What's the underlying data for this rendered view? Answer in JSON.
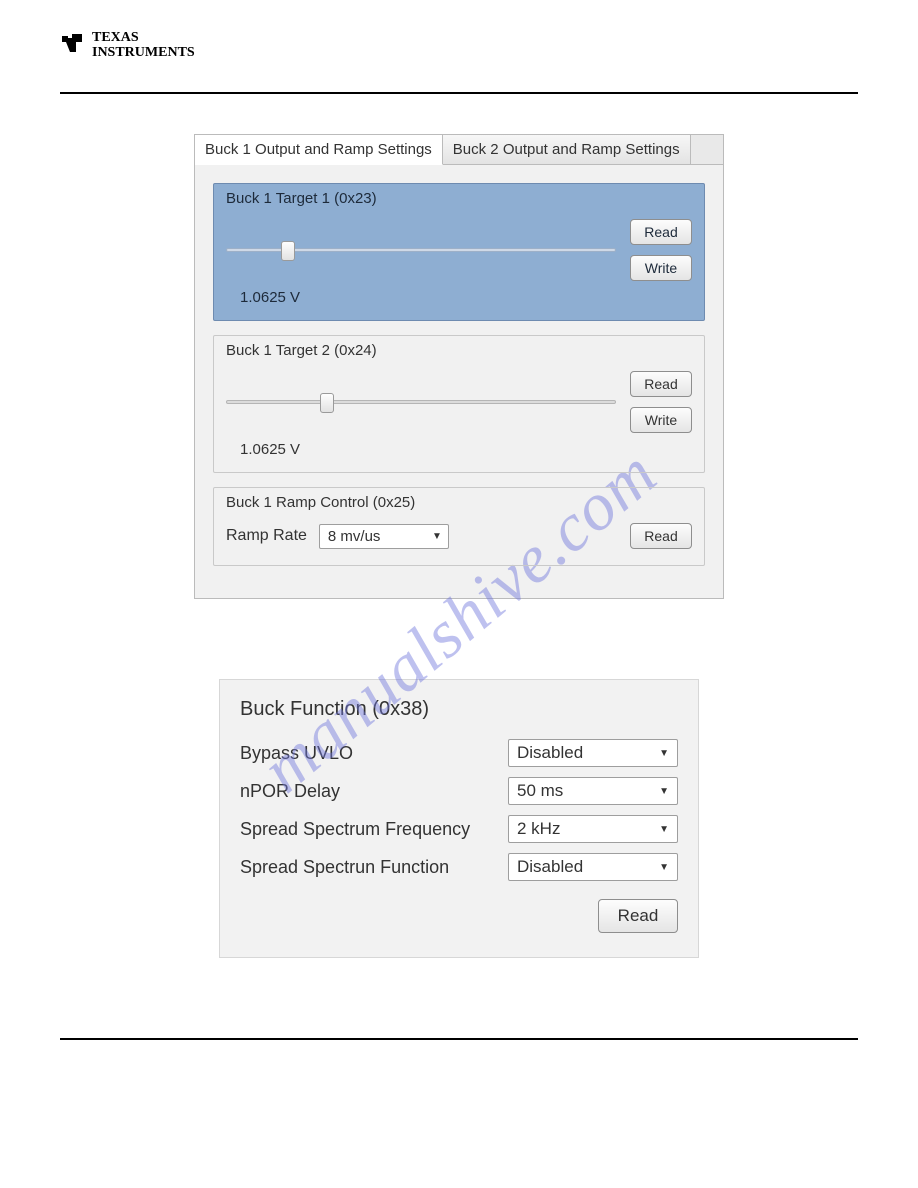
{
  "header": {
    "logo_line1": "TEXAS",
    "logo_line2": "INSTRUMENTS"
  },
  "watermark": "manualshive.com",
  "panel1": {
    "tabs": [
      {
        "label": "Buck 1 Output and Ramp Settings",
        "active": true
      },
      {
        "label": "Buck 2 Output and Ramp Settings",
        "active": false
      }
    ],
    "target1": {
      "title": "Buck 1 Target 1 (0x23)",
      "value": "1.0625 V",
      "slider_pos_pct": 14,
      "read_label": "Read",
      "write_label": "Write"
    },
    "target2": {
      "title": "Buck 1 Target 2 (0x24)",
      "value": "1.0625 V",
      "slider_pos_pct": 24,
      "read_label": "Read",
      "write_label": "Write"
    },
    "ramp": {
      "title": "Buck 1 Ramp Control (0x25)",
      "rate_label": "Ramp Rate",
      "rate_value": "8 mv/us",
      "read_label": "Read"
    }
  },
  "panel2": {
    "title": "Buck Function (0x38)",
    "rows": [
      {
        "label": "Bypass UVLO",
        "value": "Disabled"
      },
      {
        "label": "nPOR Delay",
        "value": "50 ms"
      },
      {
        "label": "Spread Spectrum Frequency",
        "value": "2 kHz"
      },
      {
        "label": "Spread Spectrun Function",
        "value": "Disabled"
      }
    ],
    "read_label": "Read"
  }
}
